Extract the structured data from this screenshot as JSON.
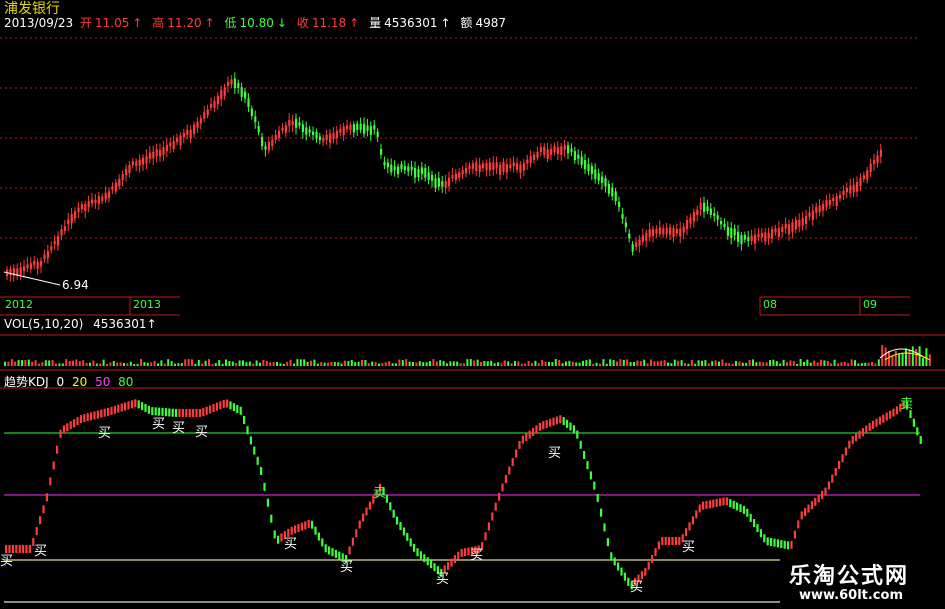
{
  "header": {
    "stock_name": "浦发银行",
    "date": "2013/09/23",
    "open_label": "开",
    "open_value": "11.05",
    "high_label": "高",
    "high_value": "11.20",
    "low_label": "低",
    "low_value": "10.80",
    "close_label": "收",
    "close_value": "11.18",
    "volume_label": "量",
    "volume_value": "4536301",
    "amount_label": "额",
    "amount_value": "4987"
  },
  "price_panel": {
    "min_label": "6.94",
    "years": [
      "2012",
      "2013"
    ],
    "months": [
      "08",
      "09"
    ]
  },
  "vol_panel": {
    "title": "VOL(5,10,20)",
    "value": "4536301"
  },
  "kdj_panel": {
    "title": "趋势KDJ",
    "levels": [
      "0",
      "20",
      "50",
      "80"
    ],
    "level_colors": {
      "0": "#ffffff",
      "20": "#ffff00",
      "50": "#ff44ff",
      "80": "#3cff3c"
    },
    "buy_label": "买",
    "sell_label": "卖"
  },
  "watermark": {
    "title": "乐淘公式网",
    "url": "www.60lt.com"
  },
  "colors": {
    "up": "#ff3c3c",
    "down": "#3cff3c",
    "grid_red": "#c01818",
    "line_green": "#22cc22",
    "line_magenta": "#cc22cc",
    "line_yellow": "#dddd88"
  }
}
